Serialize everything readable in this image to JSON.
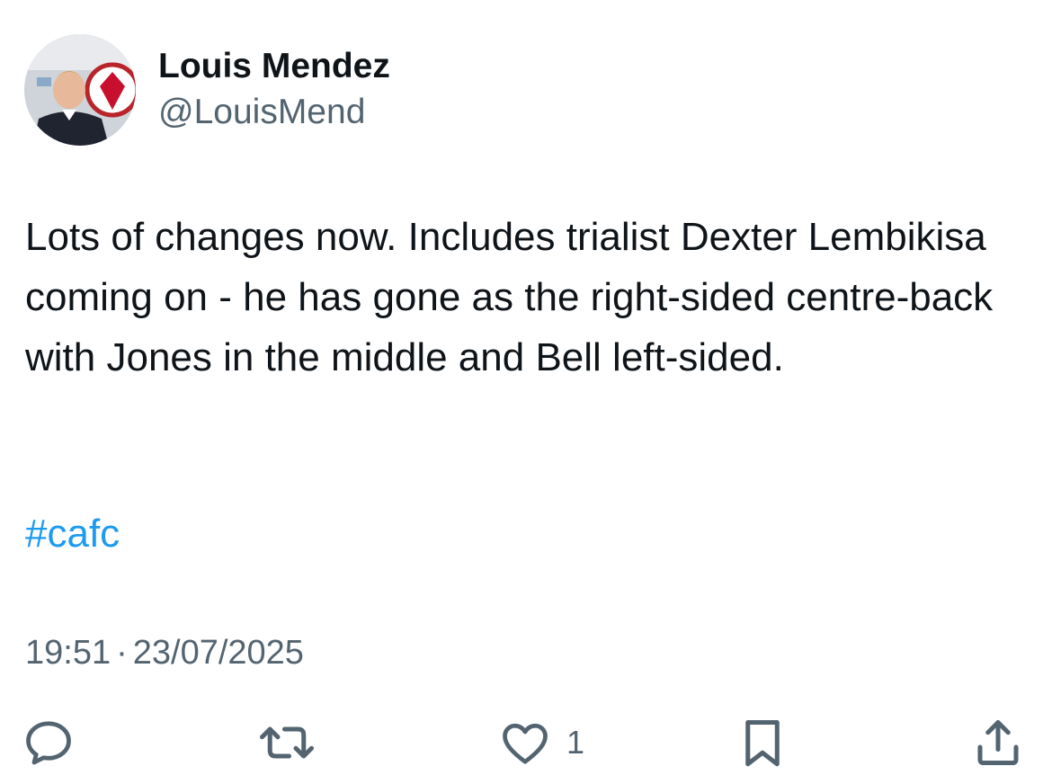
{
  "author": {
    "display_name": "Louis Mendez",
    "handle": "@LouisMend",
    "avatar_icon": "profile-photo"
  },
  "tweet": {
    "text": "Lots of changes now. Includes trialist Dexter Lembikisa coming on - he has gone as the right-sided centre-back with Jones in the middle and Bell left-sided.",
    "hashtag": "#cafc",
    "time": "19:51",
    "separator": "·",
    "date": "23/07/2025"
  },
  "actions": {
    "reply_icon": "reply-icon",
    "repost_icon": "repost-icon",
    "like_icon": "heart-icon",
    "like_count": "1",
    "bookmark_icon": "bookmark-icon",
    "share_icon": "share-icon"
  },
  "colors": {
    "text": "#0f1419",
    "secondary": "#536471",
    "link": "#1d9bf0"
  }
}
